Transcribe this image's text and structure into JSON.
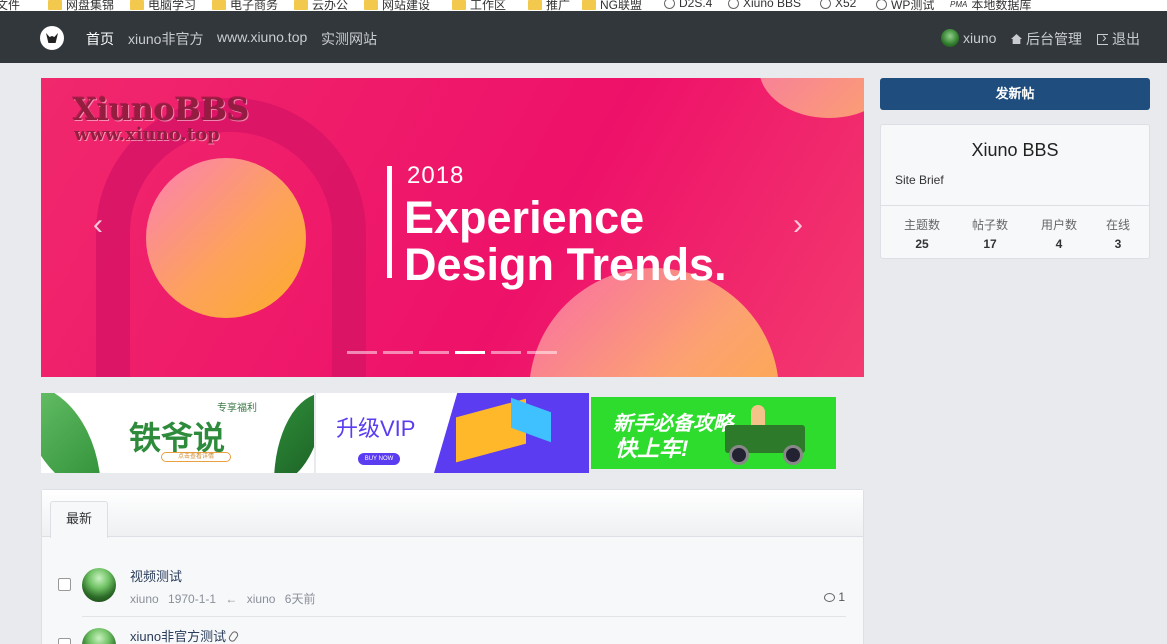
{
  "bookmarks": [
    {
      "label": "文件",
      "icon": "none"
    },
    {
      "label": "网盘集锦",
      "icon": "folder-icon"
    },
    {
      "label": "电脑学习",
      "icon": "folder-icon"
    },
    {
      "label": "电子商务",
      "icon": "folder-icon"
    },
    {
      "label": "云办公",
      "icon": "folder-icon"
    },
    {
      "label": "网站建设",
      "icon": "folder-icon"
    },
    {
      "label": "工作区",
      "icon": "folder-icon"
    },
    {
      "label": "推广",
      "icon": "folder-icon"
    },
    {
      "label": "NG联盟",
      "icon": "folder-icon"
    },
    {
      "label": "D2S.4",
      "icon": "globe-icon"
    },
    {
      "label": "Xiuno BBS",
      "icon": "globe-icon"
    },
    {
      "label": "X52",
      "icon": "globe-icon"
    },
    {
      "label": "WP测试",
      "icon": "globe-icon"
    },
    {
      "label": "本地数据库",
      "icon": "pma-icon"
    }
  ],
  "navbar": {
    "links": [
      "首页",
      "xiuno非官方",
      "www.xiuno.top",
      "实测网站"
    ],
    "user": "xiuno",
    "admin": "后台管理",
    "logout": "退出"
  },
  "carousel": {
    "watermark_title": "XiunoBBS",
    "watermark_url": "www.xiuno.top",
    "year": "2018",
    "headline_line1": "Experience",
    "headline_line2": "Design Trends.",
    "prev": "‹",
    "next": "›",
    "slide_count": 6,
    "active_slide": 4
  },
  "ads": {
    "ad1_title": "铁爷说",
    "ad1_tag": "专享福利",
    "ad1_button": "点击查看详情",
    "ad2_title": "升级VIP",
    "ad2_button": "BUY NOW",
    "ad3_line1": "新手必备攻略",
    "ad3_line2": "快上车!"
  },
  "threads": {
    "tab": "最新",
    "items": [
      {
        "title": "视频测试",
        "author": "xiuno",
        "date": "1970-1-1",
        "arrow": "←",
        "last_user": "xiuno",
        "last_time": "6天前",
        "replies": "1"
      },
      {
        "title": "xiuno非官方测试",
        "author": "",
        "date": "",
        "arrow": "",
        "last_user": "",
        "last_time": "",
        "replies": ""
      }
    ]
  },
  "sidebar": {
    "new_post": "发新帖",
    "site_name": "Xiuno BBS",
    "site_brief": "Site Brief",
    "stats": [
      {
        "label": "主题数",
        "value": "25"
      },
      {
        "label": "帖子数",
        "value": "17"
      },
      {
        "label": "用户数",
        "value": "4"
      },
      {
        "label": "在线",
        "value": "3"
      }
    ]
  },
  "colors": {
    "navbar": "#32373c",
    "carousel": "#f0176b",
    "primary_button": "#1f4e7e",
    "ad_green": "#2edc2e",
    "ad_purple": "#5b3cf0"
  }
}
